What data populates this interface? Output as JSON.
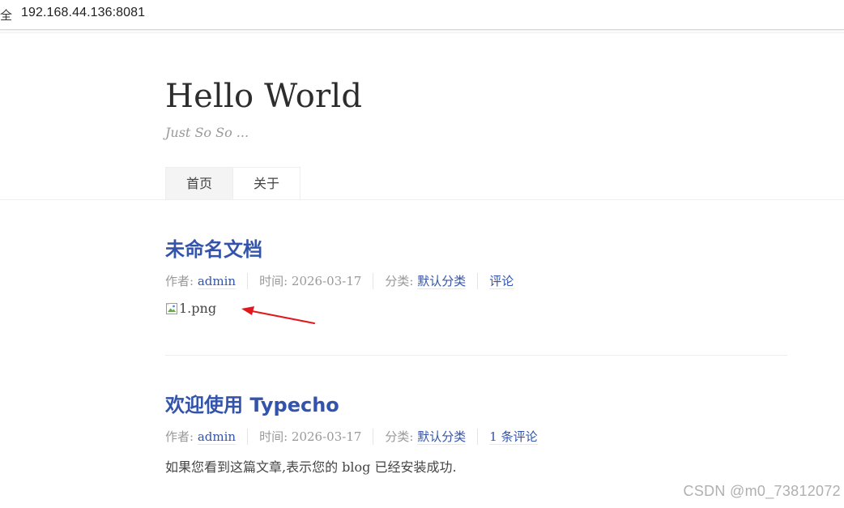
{
  "browser": {
    "security_label": "全",
    "url": "192.168.44.136:8081"
  },
  "site": {
    "title": "Hello World",
    "description": "Just So So ..."
  },
  "nav": {
    "items": [
      {
        "label": "首页",
        "active": true
      },
      {
        "label": "关于",
        "active": false
      }
    ]
  },
  "posts": [
    {
      "title": "未命名文档",
      "author_label": "作者:",
      "author": "admin",
      "time_label": "时间:",
      "time": "2026-03-17",
      "category_label": "分类:",
      "category": "默认分类",
      "comments": "评论",
      "image_alt": "1.png"
    },
    {
      "title": "欢迎使用 Typecho",
      "author_label": "作者:",
      "author": "admin",
      "time_label": "时间:",
      "time": "2026-03-17",
      "category_label": "分类:",
      "category": "默认分类",
      "comments": "1 条评论",
      "content": "如果您看到这篇文章,表示您的 blog 已经安装成功."
    }
  ],
  "watermark": "CSDN @m0_73812072",
  "colors": {
    "link": "#3354aa",
    "meta": "#999999",
    "annotation_arrow": "#e0191e"
  }
}
